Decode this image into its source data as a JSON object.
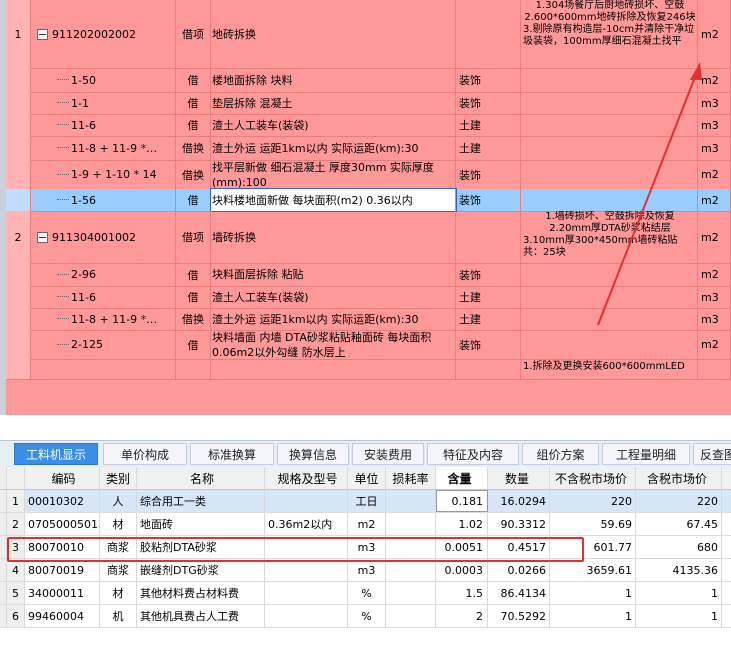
{
  "top_rows": [
    {
      "num": "1",
      "code": "911202002002",
      "cat": "借项",
      "name": "地砖拆换",
      "major": "",
      "features": [
        "1.304场餐厅后厨地砖损坏、空鼓",
        "2.600*600mm地砖拆除及恢复246块",
        "3.剔除原有构造层-10cm并清除干净垃圾装袋，100mm厚细石混凝土找平"
      ],
      "unit": "m2",
      "parent": true
    },
    {
      "num": "",
      "code": "1-50",
      "cat": "借",
      "name": "楼地面拆除 块料",
      "major": "装饰",
      "features": [],
      "unit": "m2"
    },
    {
      "num": "",
      "code": "1-1",
      "cat": "借",
      "name": "垫层拆除 混凝土",
      "major": "装饰",
      "features": [],
      "unit": "m3"
    },
    {
      "num": "",
      "code": "11-6",
      "cat": "借",
      "name": "渣土人工装车(装袋)",
      "major": "土建",
      "features": [],
      "unit": "m3"
    },
    {
      "num": "",
      "code": "11-8 + 11-9 *…",
      "cat": "借换",
      "name": "渣土外运 运距1km以内  实际运距(km):30",
      "major": "土建",
      "features": [],
      "unit": "m3"
    },
    {
      "num": "",
      "code": "1-9 + 1-10 * 14",
      "cat": "借换",
      "name": "找平层新做 细石混凝土 厚度30mm  实际厚度(mm):100",
      "major": "装饰",
      "features": [],
      "unit": "m2"
    },
    {
      "num": "",
      "code": "1-56",
      "cat": "借",
      "name": "块料楼地面新做 每块面积(m2) 0.36以内",
      "major": "装饰",
      "features": [],
      "unit": "m2",
      "selected": true
    },
    {
      "num": "2",
      "code": "911304001002",
      "cat": "借项",
      "name": "墙砖拆换",
      "major": "",
      "features": [
        "1.墙砖损坏、空鼓拆除及恢复",
        "2.20mm厚DTA砂浆粘结层",
        "3.10mm厚300*450mm墙砖粘贴共：25块"
      ],
      "unit": "m2",
      "parent": true
    },
    {
      "num": "",
      "code": "2-96",
      "cat": "借",
      "name": "块料面层拆除 粘贴",
      "major": "装饰",
      "features": [],
      "unit": "m2"
    },
    {
      "num": "",
      "code": "11-6",
      "cat": "借",
      "name": "渣土人工装车(装袋)",
      "major": "土建",
      "features": [],
      "unit": "m3"
    },
    {
      "num": "",
      "code": "11-8 + 11-9 *…",
      "cat": "借换",
      "name": "渣土外运 运距1km以内  实际运距(km):30",
      "major": "土建",
      "features": [],
      "unit": "m3"
    },
    {
      "num": "",
      "code": "2-125",
      "cat": "借",
      "name": "块料墙面 内墙 DTA砂浆粘贴釉面砖 每块面积0.06m2以外勾缝 防水层上",
      "major": "装饰",
      "features": [],
      "unit": "m2"
    },
    {
      "num": "",
      "code": "",
      "cat": "",
      "name": "",
      "major": "",
      "features": [
        "1.拆除及更换安装600*600mmLED"
      ],
      "unit": ""
    }
  ],
  "tabs": [
    "工料机显示",
    "单价构成",
    "标准换算",
    "换算信息",
    "安装费用",
    "特征及内容",
    "组价方案",
    "工程量明细",
    "反查图"
  ],
  "grid_headers": [
    "编码",
    "类别",
    "名称",
    "规格及型号",
    "单位",
    "损耗率",
    "含量",
    "数量",
    "不含税市场价",
    "含税市场价"
  ],
  "grid_rows": [
    {
      "idx": "1",
      "code": "00010302",
      "type": "人",
      "name": "综合用工一类",
      "spec": "",
      "unit": "工日",
      "loss": "",
      "content": "0.181",
      "qty": "16.0294",
      "price_ex": "220",
      "price_in": "220"
    },
    {
      "idx": "2",
      "code": "0705000501",
      "type": "材",
      "name": "地面砖",
      "spec": "0.36m2以内",
      "unit": "m2",
      "loss": "",
      "content": "1.02",
      "qty": "90.3312",
      "price_ex": "59.69",
      "price_in": "67.45"
    },
    {
      "idx": "3",
      "code": "80070010",
      "type": "商浆",
      "name": "胶粘剂DTA砂浆",
      "spec": "",
      "unit": "m3",
      "loss": "",
      "content": "0.0051",
      "qty": "0.4517",
      "price_ex": "601.77",
      "price_in": "680"
    },
    {
      "idx": "4",
      "code": "80070019",
      "type": "商浆",
      "name": "嵌缝剂DTG砂浆",
      "spec": "",
      "unit": "m3",
      "loss": "",
      "content": "0.0003",
      "qty": "0.0266",
      "price_ex": "3659.61",
      "price_in": "4135.36"
    },
    {
      "idx": "5",
      "code": "34000011",
      "type": "材",
      "name": "其他材料费占材料费",
      "spec": "",
      "unit": "%",
      "loss": "",
      "content": "1.5",
      "qty": "86.4134",
      "price_ex": "1",
      "price_in": "1"
    },
    {
      "idx": "6",
      "code": "99460004",
      "type": "机",
      "name": "其他机具费占人工费",
      "spec": "",
      "unit": "%",
      "loss": "",
      "content": "2",
      "qty": "70.5292",
      "price_ex": "1",
      "price_in": "1"
    }
  ],
  "colors": {
    "row_bg": "#ff9999",
    "selected_row": "#99ccff",
    "tab_active": "#3a8ee6",
    "highlight_border": "#e03030",
    "arrow": "#e03030"
  }
}
